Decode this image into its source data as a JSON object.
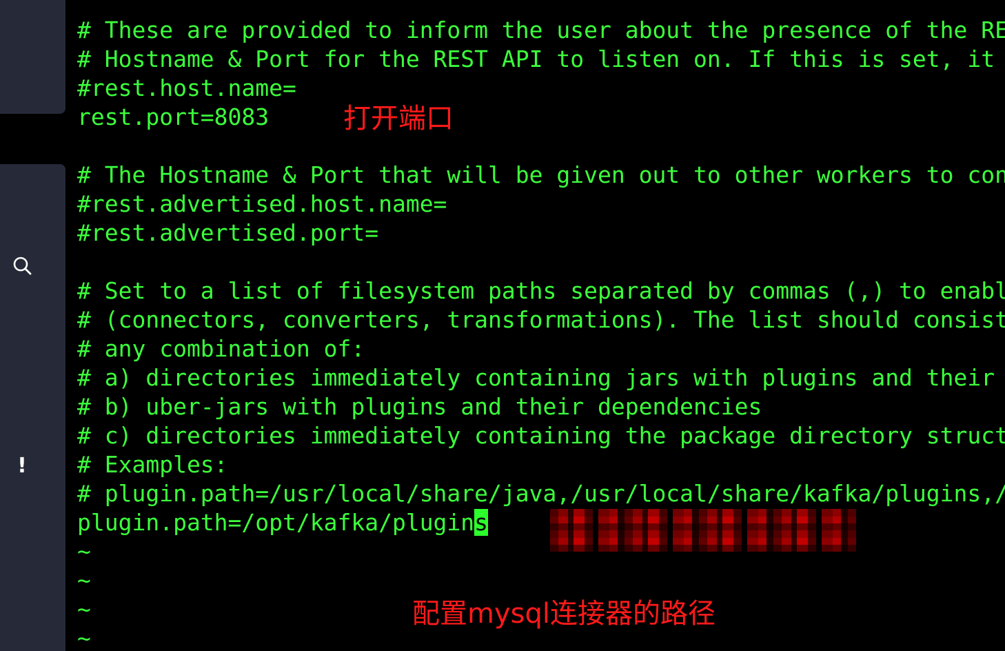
{
  "sidebar": {
    "icons": [
      "search-icon",
      "alert-icon"
    ],
    "alert_glyph": "!"
  },
  "editor": {
    "lines": [
      "# These are provided to inform the user about the presence of the RE",
      "# Hostname & Port for the REST API to listen on. If this is set, it",
      "#rest.host.name=",
      "rest.port=8083",
      "",
      "# The Hostname & Port that will be given out to other workers to con",
      "#rest.advertised.host.name=",
      "#rest.advertised.port=",
      "",
      "# Set to a list of filesystem paths separated by commas (,) to enabl",
      "# (connectors, converters, transformations). The list should consist",
      "# any combination of:",
      "# a) directories immediately containing jars with plugins and their",
      "# b) uber-jars with plugins and their dependencies",
      "# c) directories immediately containing the package directory struct",
      "# Examples:",
      "# plugin.path=/usr/local/share/java,/usr/local/share/kafka/plugins,/",
      "plugin.path=/opt/kafka/plugin",
      "~",
      "~",
      "~",
      "~"
    ],
    "cursor_line_index": 17,
    "cursor_char": "s"
  },
  "annotations": {
    "port": "打开端口",
    "path": "配置mysql连接器的路径"
  },
  "colors": {
    "text": "#3cff3c",
    "cursor": "#2dff2d",
    "annotation": "#ff1a1a",
    "sidebar": "#262a38",
    "background": "#000000"
  }
}
